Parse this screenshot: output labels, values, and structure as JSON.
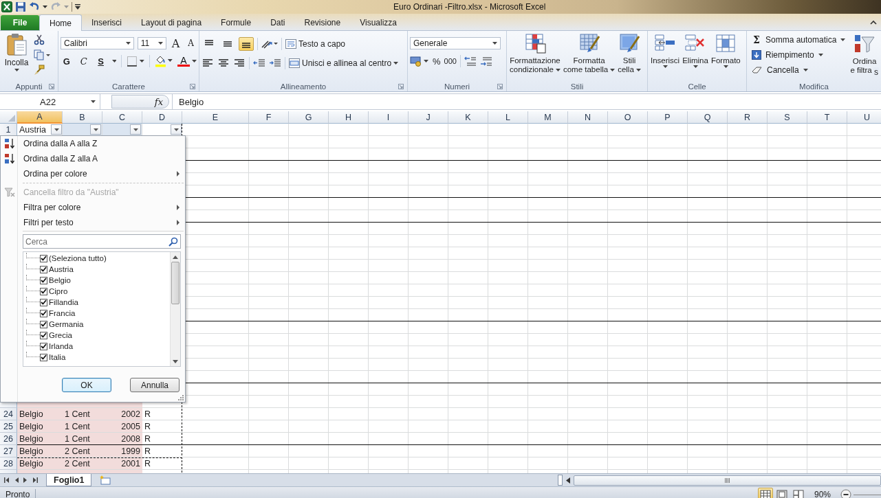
{
  "title_bar": {
    "title": "Euro Ordinari -Filtro.xlsx  -  Microsoft Excel"
  },
  "tabs": [
    {
      "label": "File",
      "selected": false
    },
    {
      "label": "Home",
      "selected": true
    },
    {
      "label": "Inserisci",
      "selected": false
    },
    {
      "label": "Layout di pagina",
      "selected": false
    },
    {
      "label": "Formule",
      "selected": false
    },
    {
      "label": "Dati",
      "selected": false
    },
    {
      "label": "Revisione",
      "selected": false
    },
    {
      "label": "Visualizza",
      "selected": false
    }
  ],
  "ribbon": {
    "clipboard": {
      "label": "Appunti",
      "paste": "Incolla"
    },
    "font": {
      "label": "Carattere",
      "family": "Calibri",
      "size": "11",
      "grow": "A",
      "shrink": "A",
      "bold": "G",
      "italic": "C",
      "underline": "S",
      "font_color_label": "A"
    },
    "alignment": {
      "label": "Allineamento",
      "wrap": "Testo a capo",
      "merge": "Unisci e allinea al centro",
      "vertical": [
        {
          "selected": false
        },
        {
          "selected": false
        },
        {
          "selected": true
        }
      ]
    },
    "number": {
      "label": "Numeri",
      "format": "Generale",
      "percent": "%",
      "thousands": "000"
    },
    "styles": {
      "label": "Stili",
      "buttons": [
        {
          "lines": [
            "Formattazione",
            "condizionale"
          ]
        },
        {
          "lines": [
            "Formatta",
            "come tabella"
          ]
        },
        {
          "lines": [
            "Stili",
            "cella"
          ]
        }
      ]
    },
    "cells": {
      "label": "Celle",
      "buttons": [
        "Inserisci",
        "Elimina",
        "Formato"
      ]
    },
    "editing": {
      "label": "Modifica",
      "sum_symbol": "Σ",
      "items": [
        "Somma automatica",
        "Riempimento",
        "Cancella"
      ],
      "sort": [
        "Ordina",
        "e filtra"
      ],
      "cut_off": "s"
    }
  },
  "formula_bar": {
    "name_box": "A22",
    "function_label": "fx",
    "value": "Belgio"
  },
  "columns": [
    {
      "label": "A",
      "selected": true
    },
    {
      "label": "B",
      "selected": false
    },
    {
      "label": "C",
      "selected": false
    },
    {
      "label": "D",
      "selected": false
    },
    {
      "label": "E",
      "selected": false
    },
    {
      "label": "F",
      "selected": false
    },
    {
      "label": "G",
      "selected": false
    },
    {
      "label": "H",
      "selected": false
    },
    {
      "label": "I",
      "selected": false
    },
    {
      "label": "J",
      "selected": false
    },
    {
      "label": "K",
      "selected": false
    },
    {
      "label": "L",
      "selected": false
    },
    {
      "label": "M",
      "selected": false
    },
    {
      "label": "N",
      "selected": false
    },
    {
      "label": "O",
      "selected": false
    },
    {
      "label": "P",
      "selected": false
    },
    {
      "label": "Q",
      "selected": false
    },
    {
      "label": "R",
      "selected": false
    },
    {
      "label": "S",
      "selected": false
    },
    {
      "label": "T",
      "selected": false
    },
    {
      "label": "U",
      "selected": false
    }
  ],
  "rows": [
    {
      "number": "1",
      "border_bottom": false,
      "cells": [
        {
          "text": "Austria",
          "filter": true
        },
        {
          "filter": true,
          "tint": true
        },
        {
          "filter": true,
          "tint": true
        },
        {
          "filter": true
        }
      ]
    },
    {
      "border_bottom": false,
      "cells": []
    },
    {
      "border_bottom": true,
      "cells": []
    },
    {
      "border_bottom": false,
      "cells": []
    },
    {
      "border_bottom": false,
      "cells": []
    },
    {
      "border_bottom": true,
      "cells": []
    },
    {
      "border_bottom": false,
      "cells": []
    },
    {
      "border_bottom": true,
      "cells": []
    },
    {
      "border_bottom": false,
      "cells": []
    },
    {
      "border_bottom": false,
      "cells": []
    },
    {
      "border_bottom": false,
      "cells": []
    },
    {
      "border_bottom": false,
      "cells": []
    },
    {
      "border_bottom": false,
      "cells": []
    },
    {
      "border_bottom": false,
      "cells": []
    },
    {
      "border_bottom": false,
      "cells": []
    },
    {
      "border_bottom": true,
      "cells": []
    },
    {
      "border_bottom": false,
      "cells": []
    },
    {
      "border_bottom": false,
      "cells": []
    },
    {
      "border_bottom": false,
      "cells": []
    },
    {
      "border_bottom": false,
      "cells": []
    },
    {
      "border_bottom": true,
      "cells": []
    },
    {
      "border_bottom": false,
      "cells": []
    },
    {
      "border_bottom": false,
      "cells": [
        {
          "fill": true
        },
        {
          "fill": true
        },
        {
          "fill": true
        }
      ]
    },
    {
      "number": "24",
      "border_bottom": false,
      "cells": [
        {
          "text": "Belgio",
          "fill": true
        },
        {
          "text": "1 Cent",
          "fill": true
        },
        {
          "text": "2002",
          "fill": true
        },
        {
          "text": "R"
        }
      ]
    },
    {
      "number": "25",
      "border_bottom": false,
      "cells": [
        {
          "text": "Belgio",
          "fill": true
        },
        {
          "text": "1 Cent",
          "fill": true
        },
        {
          "text": "2005",
          "fill": true
        },
        {
          "text": "R"
        }
      ]
    },
    {
      "number": "26",
      "border_bottom": true,
      "cells": [
        {
          "text": "Belgio",
          "fill": true
        },
        {
          "text": "1 Cent",
          "fill": true
        },
        {
          "text": "2008",
          "fill": true
        },
        {
          "text": "R"
        }
      ]
    },
    {
      "number": "27",
      "border_bottom": false,
      "dashed_bottom": true,
      "cells": [
        {
          "text": "Belgio",
          "fill": true
        },
        {
          "text": "2 Cent",
          "fill": true
        },
        {
          "text": "1999",
          "fill": true
        },
        {
          "text": "R"
        }
      ]
    },
    {
      "number": "28",
      "border_bottom": false,
      "cells": [
        {
          "text": "Belgio",
          "fill": true
        },
        {
          "text": "2 Cent",
          "fill": true
        },
        {
          "text": "2001",
          "fill": true
        },
        {
          "text": "R"
        }
      ]
    },
    {
      "cells": [
        {
          "fill": true
        },
        {
          "fill": true
        },
        {
          "fill": true
        }
      ]
    }
  ],
  "filter_menu": {
    "items": [
      {
        "kind": "ascending",
        "label": "Ordina dalla A alla Z",
        "disabled": false
      },
      {
        "kind": "descending",
        "label": "Ordina dalla Z alla A",
        "disabled": false
      },
      {
        "kind": "submenu",
        "label": "Ordina per colore",
        "disabled": false
      },
      {
        "kind": "separator"
      },
      {
        "kind": "clear",
        "label": "Cancella filtro da \"Austria\"",
        "disabled": true
      },
      {
        "kind": "submenu",
        "label": "Filtra per colore",
        "disabled": false
      },
      {
        "kind": "submenu",
        "label": "Filtri per testo",
        "disabled": false
      }
    ],
    "search": {
      "placeholder": "Cerca"
    },
    "values": [
      {
        "label": "(Seleziona tutto)",
        "checked": true
      },
      {
        "label": "Austria",
        "checked": true
      },
      {
        "label": "Belgio",
        "checked": true
      },
      {
        "label": "Cipro",
        "checked": true
      },
      {
        "label": "Fillandia",
        "checked": true
      },
      {
        "label": "Francia",
        "checked": true
      },
      {
        "label": "Germania",
        "checked": true
      },
      {
        "label": "Grecia",
        "checked": true
      },
      {
        "label": "Irlanda",
        "checked": true
      },
      {
        "label": "Italia",
        "checked": true
      }
    ],
    "buttons": [
      {
        "label": "OK",
        "focused": true
      },
      {
        "label": "Annulla",
        "focused": false
      }
    ]
  },
  "sheet_tabs": [
    {
      "label": "Foglio1",
      "selected": true
    }
  ],
  "status_bar": {
    "text": "Pronto",
    "views": [
      {
        "selected": true
      },
      {
        "selected": false
      },
      {
        "selected": false
      }
    ],
    "zoom": "90%"
  }
}
